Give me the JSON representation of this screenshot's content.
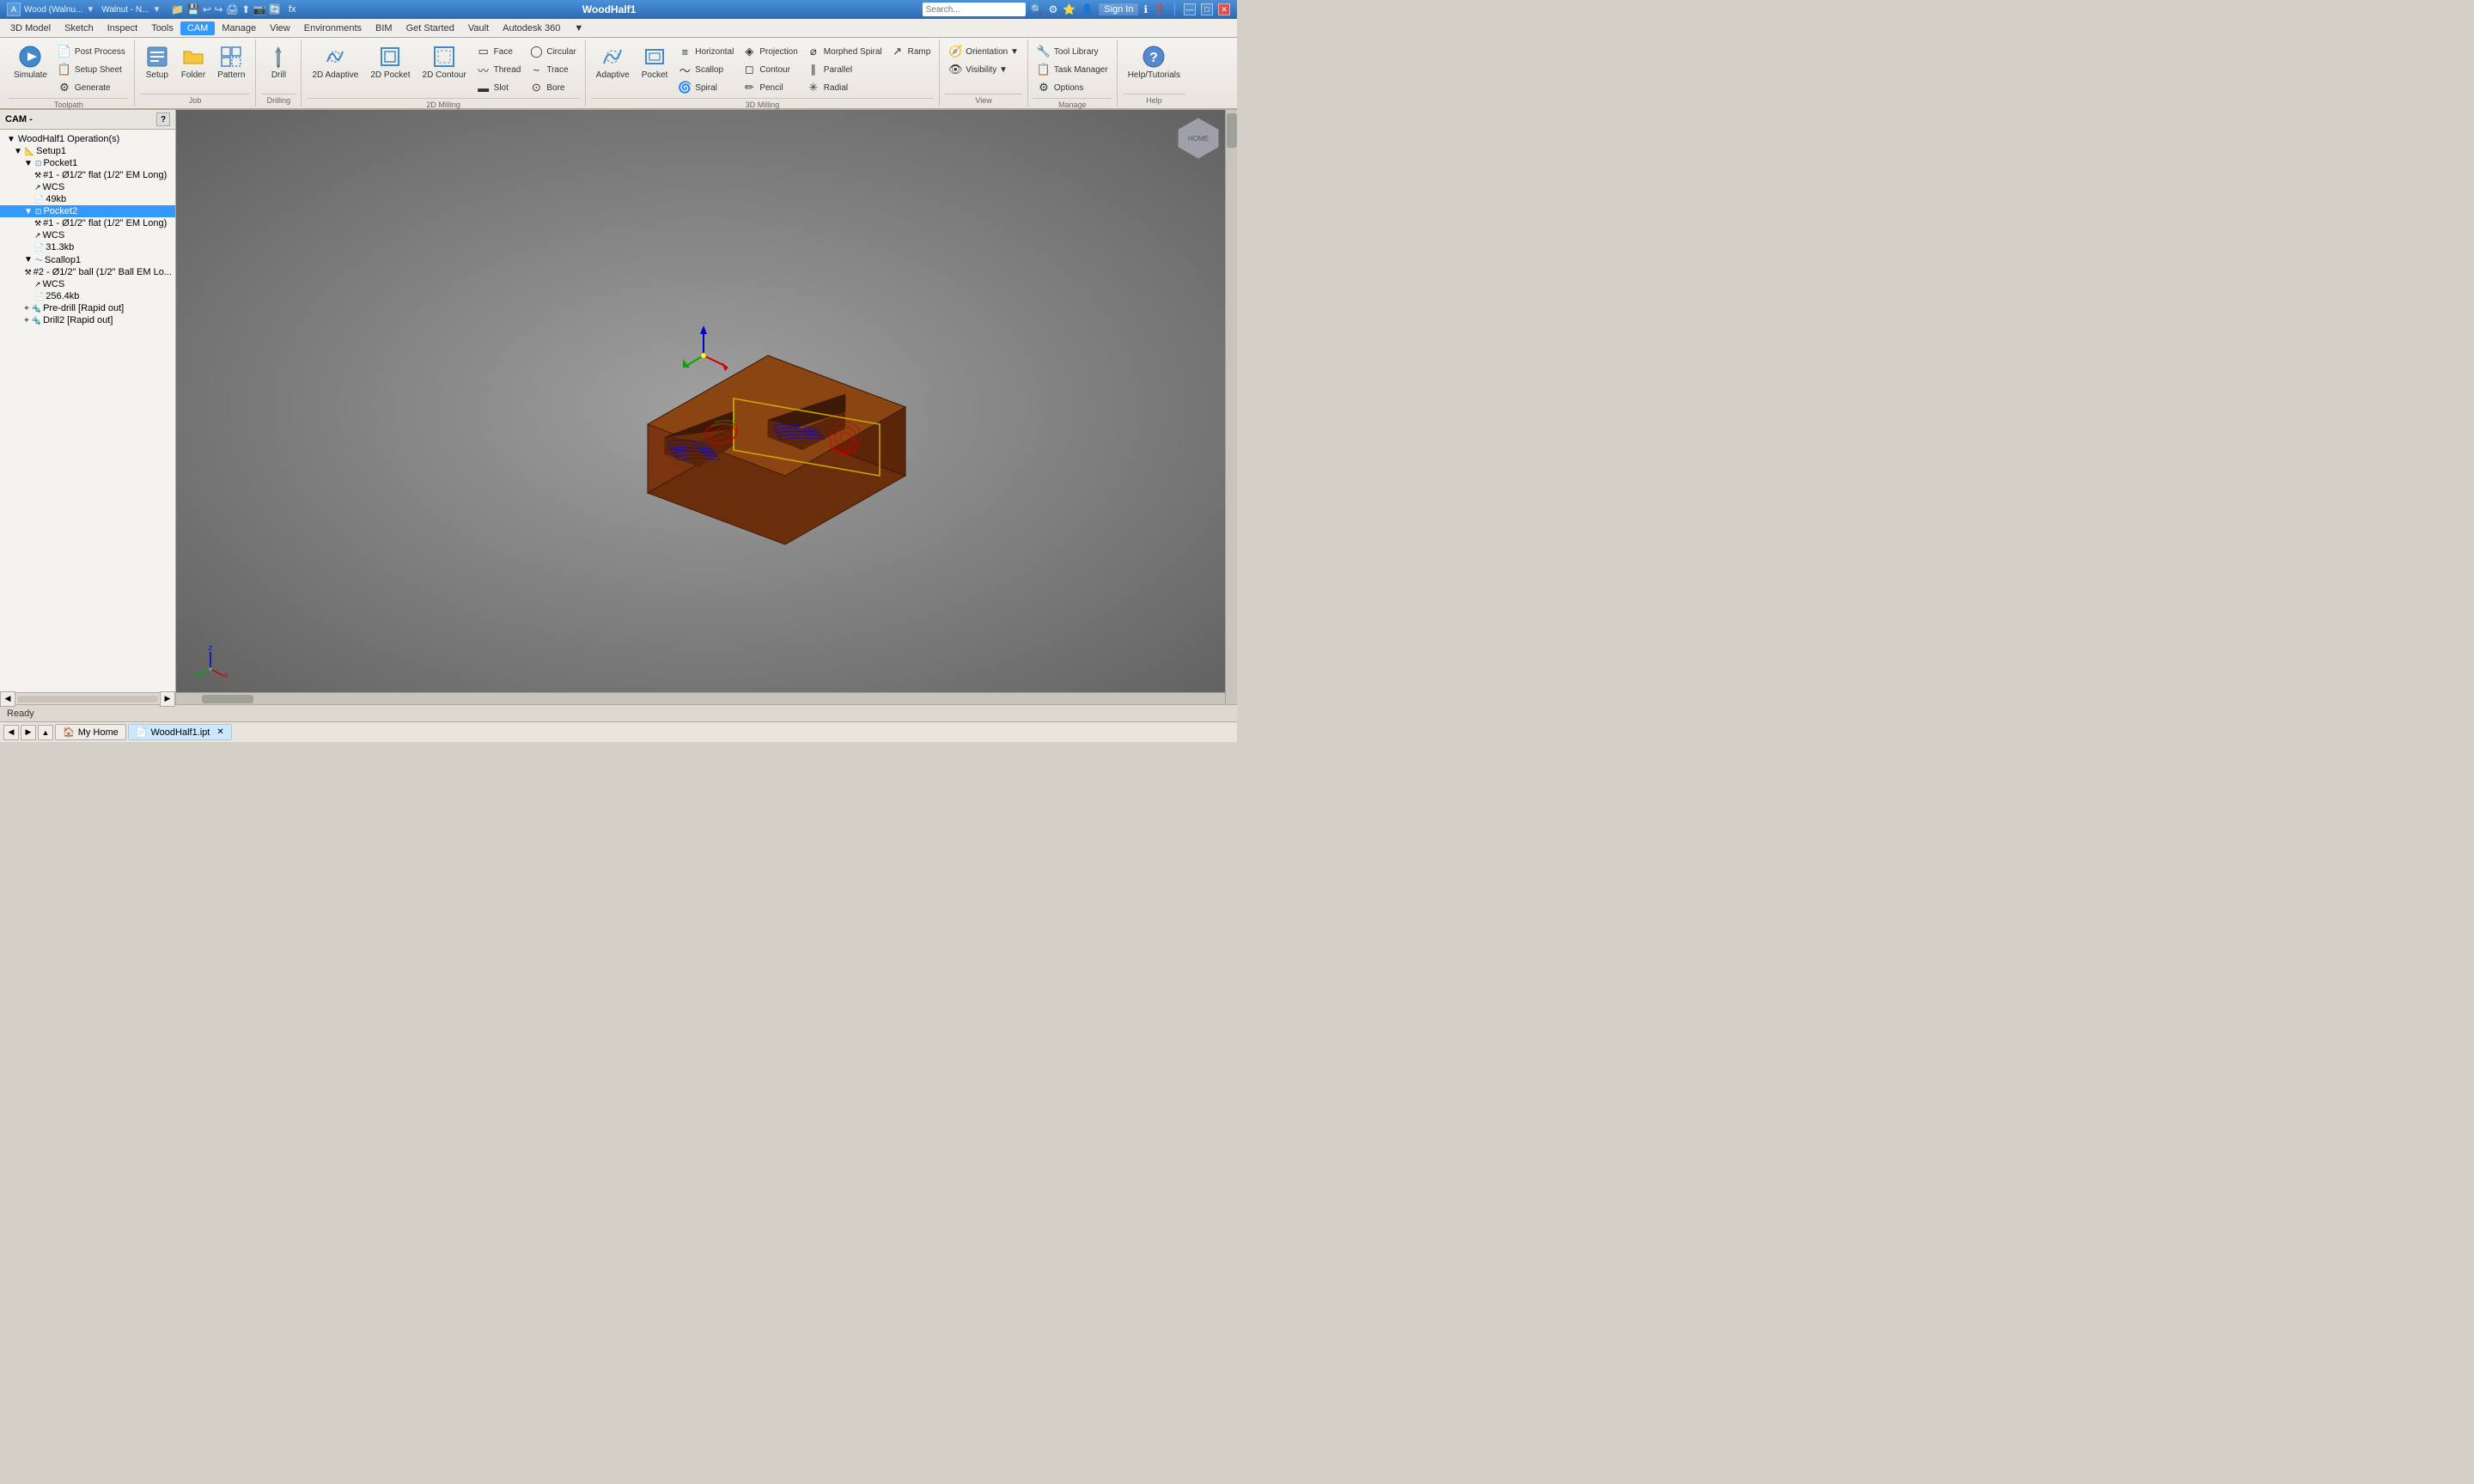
{
  "titlebar": {
    "app_icon": "A",
    "title": "WoodHalf1",
    "search_placeholder": "Search...",
    "window_controls": [
      "—",
      "□",
      "✕"
    ],
    "menu_items": [
      "3D Model",
      "Sketch",
      "Inspect",
      "Tools",
      "CAM",
      "Manage",
      "View",
      "Environments",
      "BIM",
      "Get Started",
      "Vault",
      "Autodesk 360",
      "▼"
    ],
    "sign_in": "Sign In",
    "material_dropdown": "Wood (Walnu...",
    "appearance_dropdown": "Walnut - N..."
  },
  "ribbon": {
    "active_tab": "CAM",
    "tabs": [
      "3D Model",
      "Sketch",
      "Inspect",
      "Tools",
      "CAM",
      "Manage",
      "View",
      "Environments",
      "BIM",
      "Get Started",
      "Vault",
      "Autodesk 360"
    ],
    "groups": {
      "toolpath": {
        "label": "Toolpath",
        "buttons": [
          {
            "id": "simulate",
            "label": "Simulate",
            "icon": "▶"
          },
          {
            "id": "post-process",
            "label": "Post Process",
            "icon": "📄"
          },
          {
            "id": "setup-sheet",
            "label": "Setup Sheet",
            "icon": "📋"
          },
          {
            "id": "generate",
            "label": "Generate",
            "icon": "⚙"
          }
        ]
      },
      "job": {
        "label": "Job",
        "buttons": [
          {
            "id": "setup",
            "label": "Setup",
            "icon": "🔧"
          },
          {
            "id": "folder",
            "label": "Folder",
            "icon": "📁"
          },
          {
            "id": "pattern",
            "label": "Pattern",
            "icon": "◫"
          }
        ]
      },
      "drilling": {
        "label": "Drilling",
        "buttons": [
          {
            "id": "drill",
            "label": "Drill",
            "icon": "🔩"
          }
        ]
      },
      "2d_milling": {
        "label": "2D Milling",
        "buttons": [
          {
            "id": "2d-adaptive",
            "label": "2D Adaptive",
            "icon": "⟳"
          },
          {
            "id": "2d-pocket",
            "label": "2D Pocket",
            "icon": "⬜"
          },
          {
            "id": "2d-contour",
            "label": "2D Contour",
            "icon": "◻"
          },
          {
            "id": "face",
            "label": "Face",
            "icon": "▭"
          },
          {
            "id": "thread",
            "label": "Thread",
            "icon": "〰"
          },
          {
            "id": "slot",
            "label": "Slot",
            "icon": "▬"
          },
          {
            "id": "circular",
            "label": "Circular",
            "icon": "◯"
          },
          {
            "id": "trace",
            "label": "Trace",
            "icon": "~"
          },
          {
            "id": "bore",
            "label": "Bore",
            "icon": "⊙"
          }
        ]
      },
      "3d_milling": {
        "label": "3D Milling",
        "buttons": [
          {
            "id": "adaptive",
            "label": "Adaptive",
            "icon": "⟲"
          },
          {
            "id": "pocket",
            "label": "Pocket",
            "icon": "⊡"
          },
          {
            "id": "horizontal",
            "label": "Horizontal",
            "icon": "≡"
          },
          {
            "id": "scallop",
            "label": "Scallop",
            "icon": "〜"
          },
          {
            "id": "spiral",
            "label": "Spiral",
            "icon": "🌀"
          },
          {
            "id": "projection",
            "label": "Projection",
            "icon": "◈"
          },
          {
            "id": "contour",
            "label": "Contour",
            "icon": "◻"
          },
          {
            "id": "pencil",
            "label": "Pencil",
            "icon": "✏"
          },
          {
            "id": "morphed-spiral",
            "label": "Morphed Spiral",
            "icon": "⌀"
          },
          {
            "id": "parallel",
            "label": "Parallel",
            "icon": "∥"
          },
          {
            "id": "radial",
            "label": "Radial",
            "icon": "✳"
          },
          {
            "id": "ramp",
            "label": "Ramp",
            "icon": "↗"
          }
        ]
      },
      "view": {
        "label": "View",
        "buttons": [
          {
            "id": "orientation",
            "label": "Orientation",
            "icon": "🧭"
          },
          {
            "id": "visibility",
            "label": "Visibility",
            "icon": "👁"
          }
        ]
      },
      "manage": {
        "label": "Manage",
        "buttons": [
          {
            "id": "tool-library",
            "label": "Tool Library",
            "icon": "🔧"
          },
          {
            "id": "task-manager",
            "label": "Task Manager",
            "icon": "📋"
          },
          {
            "id": "options",
            "label": "Options",
            "icon": "⚙"
          }
        ]
      },
      "help": {
        "label": "Help",
        "buttons": [
          {
            "id": "help-tutorials",
            "label": "Help/Tutorials",
            "icon": "?"
          }
        ]
      }
    }
  },
  "cam_panel": {
    "header": "CAM -",
    "help_icon": "?",
    "root_label": "WoodHalf1 Operation(s)",
    "tree": [
      {
        "id": "setup1",
        "label": "Setup1",
        "level": 1,
        "icon": "📐",
        "expanded": true,
        "type": "setup"
      },
      {
        "id": "pocket1",
        "label": "Pocket1",
        "level": 2,
        "icon": "⊡",
        "expanded": true,
        "type": "operation"
      },
      {
        "id": "pocket1-tool",
        "label": "#1 - Ø1/2\" flat (1/2\" EM Long)",
        "level": 3,
        "icon": "⚒",
        "type": "tool"
      },
      {
        "id": "pocket1-wcs",
        "label": "WCS",
        "level": 3,
        "icon": "↗",
        "type": "wcs"
      },
      {
        "id": "pocket1-size",
        "label": "49kb",
        "level": 3,
        "icon": "📄",
        "type": "file"
      },
      {
        "id": "pocket2",
        "label": "Pocket2",
        "level": 2,
        "icon": "⊡",
        "expanded": true,
        "type": "operation",
        "selected": true
      },
      {
        "id": "pocket2-tool",
        "label": "#1 - Ø1/2\" flat (1/2\" EM Long)",
        "level": 3,
        "icon": "⚒",
        "type": "tool"
      },
      {
        "id": "pocket2-wcs",
        "label": "WCS",
        "level": 3,
        "icon": "↗",
        "type": "wcs"
      },
      {
        "id": "pocket2-size",
        "label": "31.3kb",
        "level": 3,
        "icon": "📄",
        "type": "file"
      },
      {
        "id": "scallop1",
        "label": "Scallop1",
        "level": 2,
        "icon": "〜",
        "expanded": true,
        "type": "operation"
      },
      {
        "id": "scallop1-tool",
        "label": "#2 - Ø1/2\" ball (1/2\" Ball EM Lo...",
        "level": 3,
        "icon": "⚒",
        "type": "tool"
      },
      {
        "id": "scallop1-wcs",
        "label": "WCS",
        "level": 3,
        "icon": "↗",
        "type": "wcs"
      },
      {
        "id": "scallop1-size",
        "label": "256.4kb",
        "level": 3,
        "icon": "📄",
        "type": "file"
      },
      {
        "id": "pre-drill",
        "label": "Pre-drill [Rapid out]",
        "level": 2,
        "icon": "🔩",
        "type": "operation"
      },
      {
        "id": "drill2",
        "label": "Drill2 [Rapid out]",
        "level": 2,
        "icon": "🔩",
        "type": "operation"
      }
    ],
    "scroll_left": "◀",
    "scroll_right": "▶"
  },
  "viewport": {
    "background_start": "#a0a0a0",
    "background_end": "#606060"
  },
  "statusbar": {
    "text": "Ready"
  },
  "taskbar": {
    "items": [
      {
        "id": "my-home",
        "label": "My Home",
        "icon": "🏠"
      },
      {
        "id": "woodhalf1",
        "label": "WoodHalf1.ipt",
        "icon": "📄",
        "active": true,
        "closable": true
      }
    ],
    "nav_buttons": [
      "◀",
      "▶",
      "▲"
    ]
  }
}
